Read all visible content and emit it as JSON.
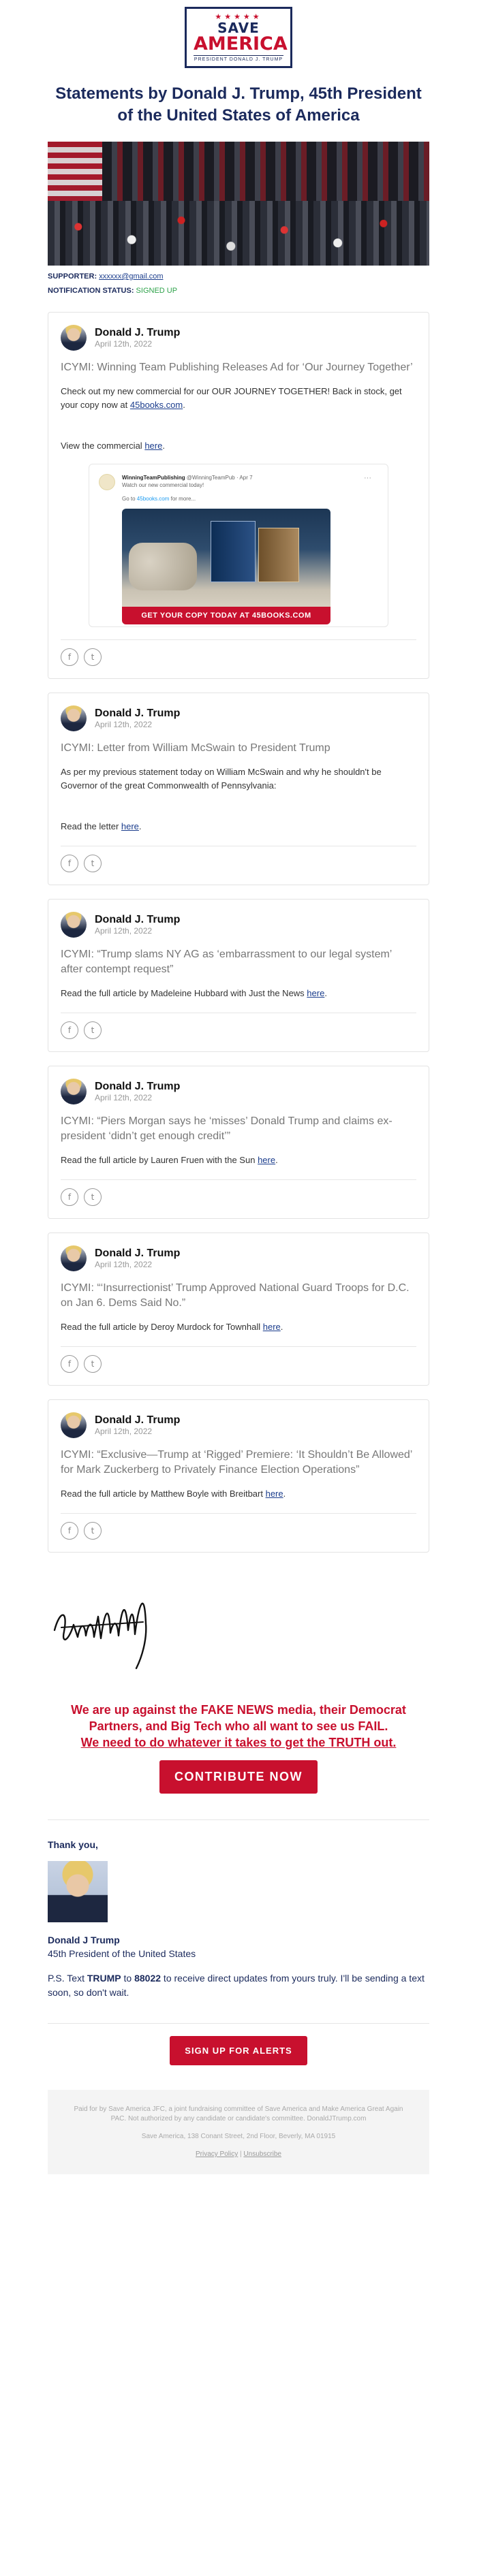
{
  "logo": {
    "stars": "★★★★★",
    "line1": "SAVE",
    "line2": "AMERICA",
    "sub": "PRESIDENT DONALD J. TRUMP"
  },
  "headline": "Statements by Donald J. Trump, 45th President of the United States of America",
  "meta": {
    "supporter_label": "SUPPORTER:",
    "supporter_value": "xxxxxx@gmail.com",
    "status_label": "NOTIFICATION STATUS:",
    "status_value": "SIGNED UP"
  },
  "posts": [
    {
      "author": "Donald J. Trump",
      "date": "April 12th, 2022",
      "title": "ICYMI: Winning Team Publishing Releases Ad for ‘Our Journey Together’",
      "body_pre": "Check out my new commercial for our OUR JOURNEY TOGETHER! Back in stock, get your copy now at ",
      "body_link": "45books.com",
      "body_post": ".",
      "body2_pre": "View the commercial ",
      "body2_link": "here",
      "body2_post": ".",
      "embed": {
        "handle": "WinningTeamPublishing",
        "at": "@WinningTeamPub",
        "when": "Apr 7",
        "dots": "···",
        "caption": "Watch our new commercial today!",
        "link_pre": "Go to ",
        "link": "45books.com",
        "link_post": " for more...",
        "banner": "GET YOUR COPY TODAY AT 45BOOKS.COM"
      }
    },
    {
      "author": "Donald J. Trump",
      "date": "April 12th, 2022",
      "title": "ICYMI: Letter from William McSwain to President Trump",
      "body_pre": "As per my previous statement today on William McSwain and why he shouldn't be Governor of the great Commonwealth of Pennsylvania:",
      "body2_pre": "Read the letter ",
      "body2_link": "here",
      "body2_post": "."
    },
    {
      "author": "Donald J. Trump",
      "date": "April 12th, 2022",
      "title": "ICYMI: “Trump slams NY AG as ‘embarrassment to our legal system’ after contempt request”",
      "body_pre": "Read the full article by Madeleine Hubbard with Just the News ",
      "body_link": "here",
      "body_post": "."
    },
    {
      "author": "Donald J. Trump",
      "date": "April 12th, 2022",
      "title": "ICYMI: “Piers Morgan says he ‘misses’ Donald Trump and claims ex-president ‘didn’t get enough credit’”",
      "body_pre": "Read the full article by Lauren Fruen with the Sun ",
      "body_link": "here",
      "body_post": "."
    },
    {
      "author": "Donald J. Trump",
      "date": "April 12th, 2022",
      "title": "ICYMI: “‘Insurrectionist’ Trump Approved National Guard Troops for D.C. on Jan 6. Dems Said No.”",
      "body_pre": "Read the full article by Deroy Murdock for Townhall ",
      "body_link": "here",
      "body_post": "."
    },
    {
      "author": "Donald J. Trump",
      "date": "April 12th, 2022",
      "title": "ICYMI: “Exclusive—Trump at ‘Rigged’ Premiere: ‘It Shouldn’t Be Allowed’ for Mark Zuckerberg to Privately Finance Election Operations”",
      "body_pre": "Read the full article by Matthew Boyle with Breitbart ",
      "body_link": "here",
      "body_post": "."
    }
  ],
  "share": {
    "facebook": "f",
    "twitter": "t"
  },
  "appeal": {
    "line1": "We are up against the FAKE NEWS media, their Democrat Partners, and Big Tech who all want to see us FAIL.",
    "line2": "We need to do whatever it takes to get the TRUTH out."
  },
  "contribute_label": "CONTRIBUTE NOW",
  "closing": {
    "thanks": "Thank you,",
    "name": "Donald J Trump",
    "title": "45th President of the United States",
    "ps_pre": "P.S. Text ",
    "ps_keyword": "TRUMP",
    "ps_mid": " to ",
    "ps_number": "88022",
    "ps_post": " to receive direct updates from yours truly. I'll be sending a text soon, so don't wait."
  },
  "alerts_label": "SIGN UP FOR ALERTS",
  "footer": {
    "paid": "Paid for by Save America JFC, a joint fundraising committee of Save America and Make America Great Again PAC. Not authorized by any candidate or candidate's committee. DonaldJTrump.com",
    "address": "Save America, 138 Conant Street, 2nd Floor, Beverly, MA 01915",
    "privacy": "Privacy Policy",
    "sep": " | ",
    "unsubscribe": "Unsubscribe"
  },
  "colors": {
    "navy": "#1b2a5c",
    "red": "#c8102e",
    "green": "#2ea24a"
  }
}
